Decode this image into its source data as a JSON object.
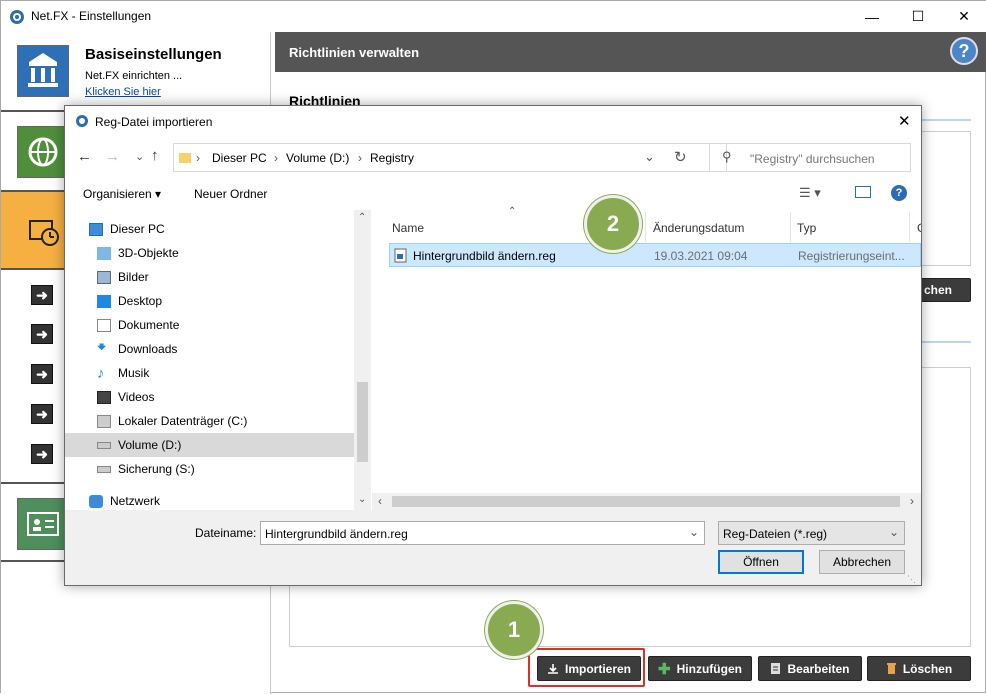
{
  "main_window": {
    "title": "Net.FX - Einstellungen",
    "sidebar": {
      "basic_title": "Basiseinstellungen",
      "basic_subtitle": "Net.FX einrichten ...",
      "basic_link": "Klicken Sie hier"
    },
    "right_panel": {
      "header": "Richtlinien verwalten",
      "section_title": "Richtlinien",
      "partial_button": "chen",
      "buttons": {
        "import": "Importieren",
        "add": "Hinzufügen",
        "edit": "Bearbeiten",
        "delete": "Löschen"
      }
    }
  },
  "dialog": {
    "title": "Reg-Datei importieren",
    "breadcrumb": [
      "Dieser PC",
      "Volume (D:)",
      "Registry"
    ],
    "search_placeholder": "\"Registry\" durchsuchen",
    "toolbar": {
      "organize": "Organisieren",
      "new_folder": "Neuer Ordner"
    },
    "nav_tree": {
      "this_pc": "Dieser PC",
      "items": [
        "3D-Objekte",
        "Bilder",
        "Desktop",
        "Dokumente",
        "Downloads",
        "Musik",
        "Videos",
        "Lokaler Datenträger (C:)",
        "Volume (D:)",
        "Sicherung (S:)"
      ],
      "network": "Netzwerk"
    },
    "columns": {
      "name": "Name",
      "date": "Änderungsdatum",
      "type": "Typ",
      "size": "G"
    },
    "files": [
      {
        "name": "Hintergrundbild ändern.reg",
        "date": "19.03.2021 09:04",
        "type": "Registrierungseint..."
      }
    ],
    "filename_label": "Dateiname:",
    "filename_value": "Hintergrundbild ändern.reg",
    "filetype_value": "Reg-Dateien (*.reg)",
    "open_button": "Öffnen",
    "cancel_button": "Abbrechen"
  },
  "annotations": {
    "step1": "1",
    "step2": "2"
  },
  "colors": {
    "accent_orange": "#f5b041",
    "header_gray": "#555555",
    "badge_green": "#8aaa52",
    "highlight_red": "#d9302a",
    "selection_blue": "#cce8ff"
  }
}
